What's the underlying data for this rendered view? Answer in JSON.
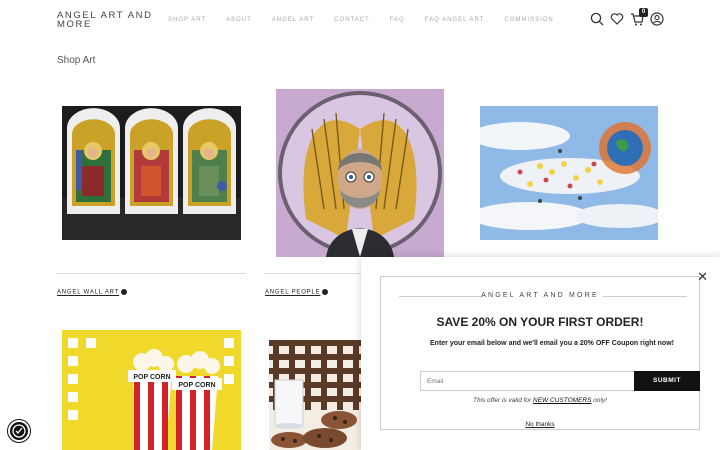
{
  "header": {
    "logo": "ANGEL ART AND MORE",
    "nav": [
      "SHOP ART",
      "ABOUT",
      "ANGEL ART",
      "CONTACT",
      "FAQ",
      "FAQ ANGEL ART",
      "COMMISSION"
    ],
    "icons": [
      "search-icon",
      "heart-icon",
      "cart-icon",
      "account-icon"
    ],
    "cart_count": "0"
  },
  "page_title": "Shop Art",
  "products": [
    {
      "label": "ANGEL WALL ART"
    },
    {
      "label": "ANGEL PEOPLE"
    }
  ],
  "popup": {
    "brand": "ANGEL ART AND MORE",
    "headline": "SAVE 20% ON YOUR FIRST ORDER!",
    "subtext": "Enter your email below and we'll email you a 20% OFF Coupon right now!",
    "email_placeholder": "Email",
    "submit_label": "SUBMIT",
    "disclaimer_prefix": "This offer is valid for ",
    "disclaimer_link": "NEW CUSTOMERS",
    "disclaimer_suffix": " only!",
    "no_thanks": "No thanks",
    "close_glyph": "✕"
  },
  "colors": {
    "accent": "#111111",
    "nav_text": "#aaaaaa"
  }
}
